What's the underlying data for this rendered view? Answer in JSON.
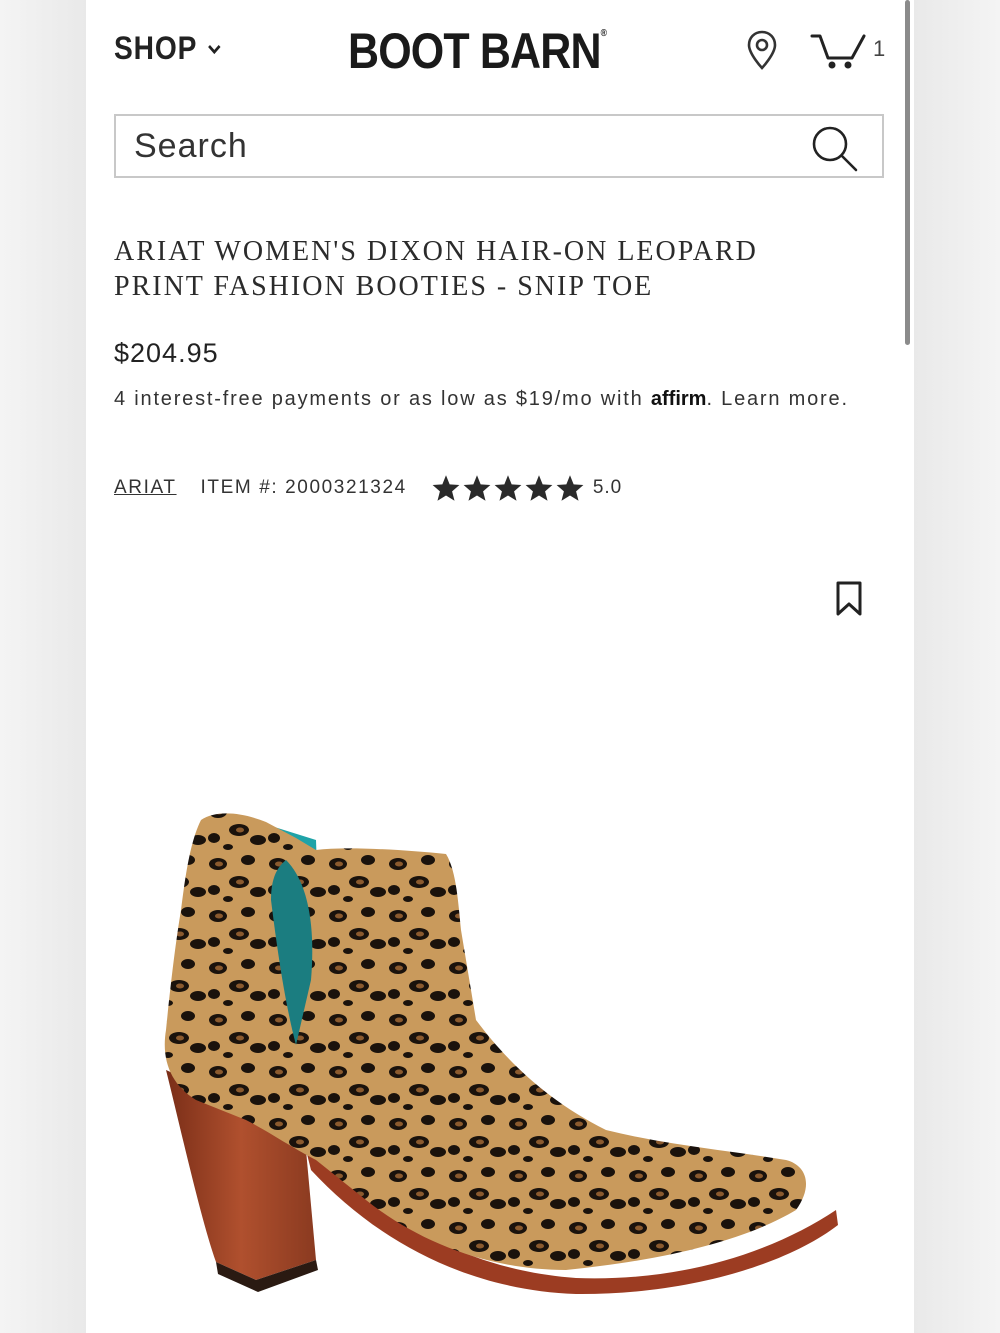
{
  "header": {
    "shop_label": "SHOP",
    "logo_text": "BOOT BARN",
    "logo_mark": "®",
    "cart_count": "1"
  },
  "search": {
    "placeholder": "Search"
  },
  "product": {
    "title": "ARIAT WOMEN'S DIXON HAIR-ON LEOPARD PRINT FASHION BOOTIES - SNIP TOE",
    "price": "$204.95",
    "payments_text": "4 interest-free payments or as low as $19/mo with ",
    "affirm_label": "affirm",
    "learn_more": ". Learn more.",
    "brand": "ARIAT",
    "item_number": "ITEM #: 2000321324",
    "rating": "5.0",
    "rating_value": 5,
    "rating_max": 5
  },
  "colors": {
    "star": "#2a2a2a",
    "heel": "#a3472b",
    "lining": "#1fa3a8",
    "leopard_base": "#c99a5c"
  },
  "icons": [
    "chevron-down-icon",
    "location-pin-icon",
    "cart-icon",
    "search-icon",
    "bookmark-icon",
    "star-icon"
  ]
}
